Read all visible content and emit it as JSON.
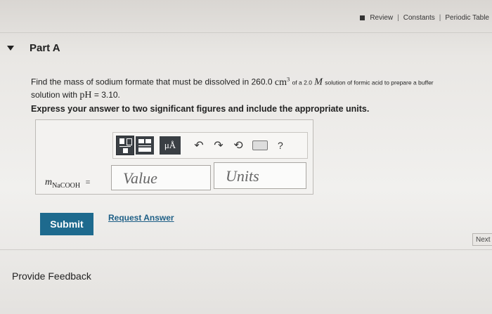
{
  "header": {
    "review": "Review",
    "constants": "Constants",
    "periodic_table": "Periodic Table",
    "separator": "|"
  },
  "part": {
    "title": "Part A"
  },
  "question": {
    "text_start": "Find the mass of sodium formate that must be dissolved in 260.0",
    "unit": "cm",
    "unit_exp": "3",
    "text_middle": "of a 2.0",
    "molarity_symbol": "M",
    "text_end": "solution of formic acid to prepare a buffer",
    "line2_start": "solution with",
    "ph_label": "pH",
    "ph_value": "= 3.10."
  },
  "instruction": "Express your answer to two significant figures and include the appropriate units.",
  "answer": {
    "variable": "m",
    "variable_sub": "NaCOOH",
    "equals": "=",
    "value_placeholder": "Value",
    "units_placeholder": "Units"
  },
  "toolbar": {
    "units_button": "μÅ",
    "undo_icon": "↶",
    "redo_icon": "↷",
    "reset_icon": "⟲",
    "help": "?"
  },
  "actions": {
    "submit": "Submit",
    "request_answer": "Request Answer",
    "provide_feedback": "Provide Feedback",
    "next": "Next"
  }
}
